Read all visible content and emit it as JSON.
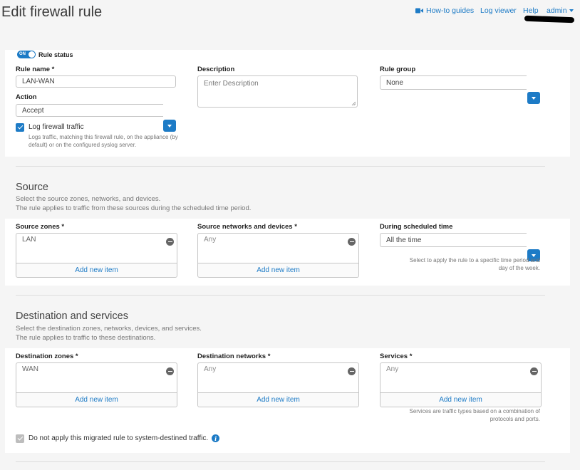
{
  "page": {
    "title": "Edit firewall rule"
  },
  "topnav": {
    "howto": "How-to guides",
    "logviewer": "Log viewer",
    "help": "Help",
    "admin": "admin"
  },
  "rule": {
    "toggle_state": "ON",
    "status_label": "Rule status",
    "name_label": "Rule name *",
    "name_value": "LAN-WAN",
    "description_label": "Description",
    "description_placeholder": "Enter Description",
    "group_label": "Rule group",
    "group_value": "None",
    "action_label": "Action",
    "action_value": "Accept",
    "log_label": "Log firewall traffic",
    "log_checked": true,
    "log_hint": "Logs traffic, matching this firewall rule, on the appliance (by default) or on the configured syslog server."
  },
  "source": {
    "title": "Source",
    "desc1": "Select the source zones, networks, and devices.",
    "desc2": "The rule applies to traffic from these sources during the scheduled time period.",
    "zones_label": "Source zones *",
    "zones_value": "LAN",
    "networks_label": "Source networks and devices *",
    "networks_value": "Any",
    "schedule_label": "During scheduled time",
    "schedule_value": "All the time",
    "schedule_hint": "Select to apply the rule to a specific time period and day of the week.",
    "add_new": "Add new item"
  },
  "destination": {
    "title": "Destination and services",
    "desc1": "Select the destination zones, networks, devices, and services.",
    "desc2": "The rule applies to traffic to these destinations.",
    "zones_label": "Destination zones *",
    "zones_value": "WAN",
    "networks_label": "Destination networks *",
    "networks_value": "Any",
    "services_label": "Services *",
    "services_value": "Any",
    "services_hint": "Services are traffic types based on a combination of protocols and ports.",
    "add_new": "Add new item",
    "migrated_label": "Do not apply this migrated rule to system-destined traffic."
  },
  "colors": {
    "accent": "#1d7bc6",
    "checkbox_disabled": "#bdbdbd"
  }
}
